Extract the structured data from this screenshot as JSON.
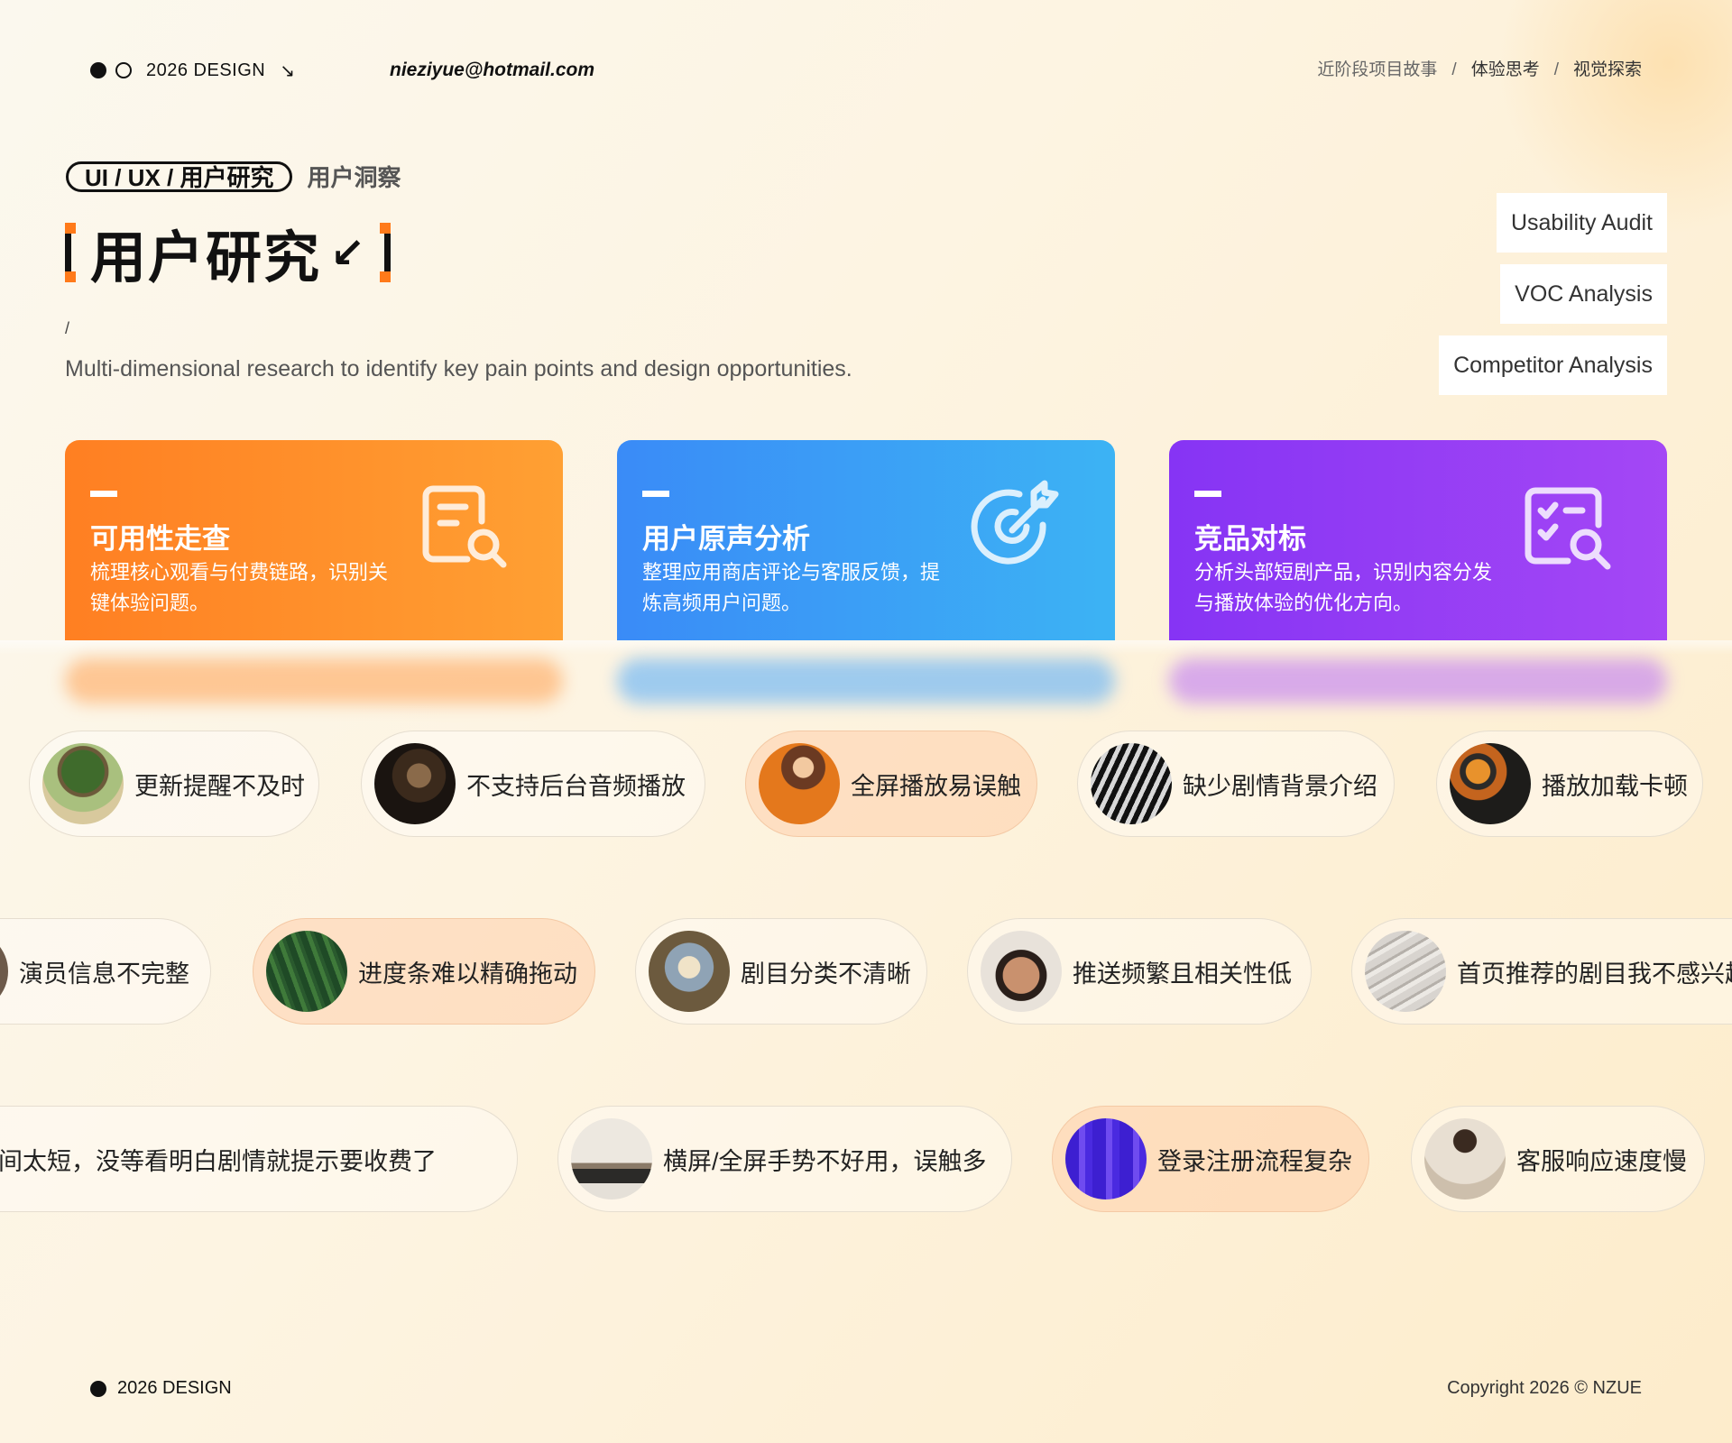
{
  "header": {
    "year_label": "2026  DESIGN",
    "arrow": "↘",
    "email": "nieziyue@hotmail.com",
    "nav": [
      {
        "label": "近阶段项目故事"
      },
      {
        "label": "体验思考"
      },
      {
        "label": "视觉探索"
      }
    ],
    "nav_sep": "/"
  },
  "hero": {
    "pill": "UI / UX / 用户研究",
    "tag_sub": "用户洞察",
    "title": "用户研究",
    "title_arrow": "↙",
    "slash": "/",
    "subtitle": "Multi-dimensional research to identify key pain points and design opportunities."
  },
  "chips": [
    "Usability Audit",
    "VOC Analysis",
    "Competitor Analysis"
  ],
  "cards": [
    {
      "title": "可用性走查",
      "desc": "梳理核心观看与付费链路，识别关键体验问题。",
      "icon": "document-search-icon"
    },
    {
      "title": "用户原声分析",
      "desc": "整理应用商店评论与客服反馈，提炼高频用户问题。",
      "icon": "target-arrow-icon"
    },
    {
      "title": "竞品对标",
      "desc": "分析头部短剧产品，识别内容分发与播放体验的优化方向。",
      "icon": "checklist-search-icon"
    }
  ],
  "tags": {
    "row1": [
      {
        "label": "更新提醒不及时",
        "avatar": "tree-photo"
      },
      {
        "label": "不支持后台音频播放",
        "avatar": "portrait-painting-photo"
      },
      {
        "label": "全屏播放易误触",
        "avatar": "profile-orange-photo"
      },
      {
        "label": "缺少剧情背景介绍",
        "avatar": "zebra-photo"
      },
      {
        "label": "播放加载卡顿",
        "avatar": "food-bowls-photo"
      }
    ],
    "row2": [
      {
        "label": "演员信息不完整",
        "avatar": "portrait-photo"
      },
      {
        "label": "进度条难以精确拖动",
        "avatar": "leaves-photo"
      },
      {
        "label": "剧目分类不清晰",
        "avatar": "ceiling-painting-photo"
      },
      {
        "label": "推送频繁且相关性低",
        "avatar": "man-portrait-photo"
      },
      {
        "label": "首页推荐的剧目我不感兴趣",
        "avatar": "sand-waves-photo"
      }
    ],
    "row3": [
      {
        "label": "试看时间太短，没等看明白剧情就提示要收费了",
        "avatar": "abstract-photo"
      },
      {
        "label": "横屏/全屏手势不好用，误触多",
        "avatar": "interior-photo"
      },
      {
        "label": "登录注册流程复杂",
        "avatar": "purple-shapes-photo"
      },
      {
        "label": "客服响应速度慢",
        "avatar": "person-beige-photo"
      }
    ]
  },
  "footer": {
    "year_label": "2026  DESIGN",
    "copyright": "Copyright 2026 © NZUE"
  }
}
